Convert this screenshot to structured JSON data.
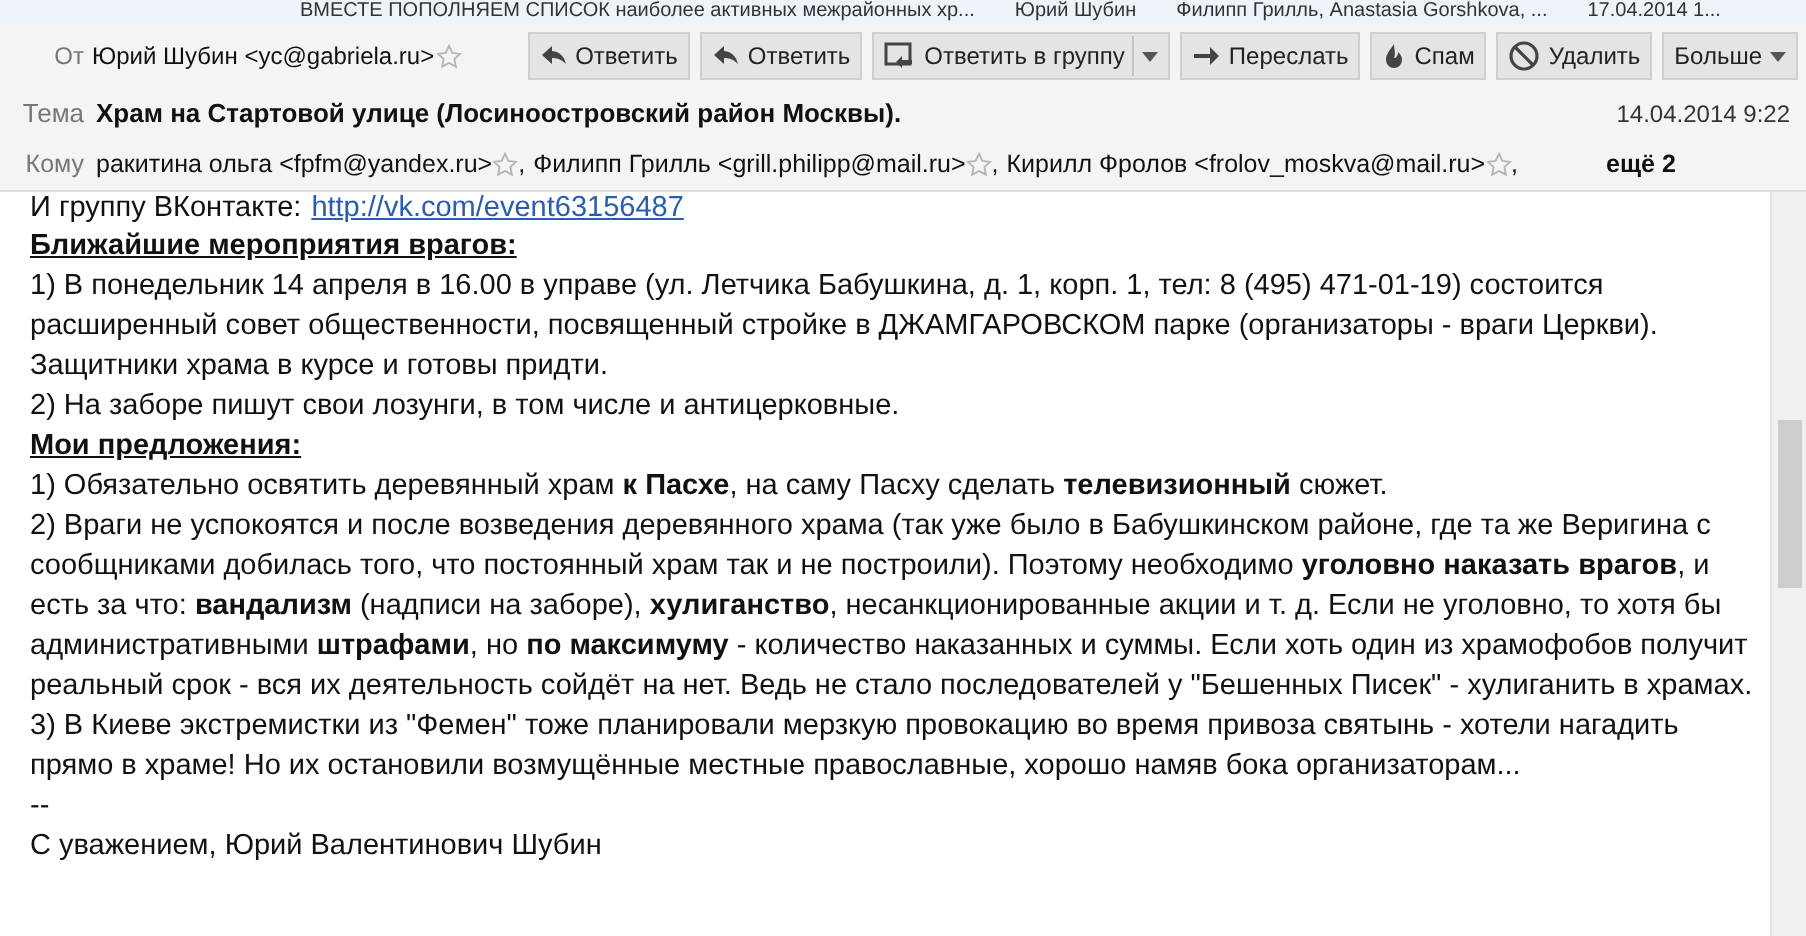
{
  "message_list_row": {
    "subject": "ВМЕСТЕ ПОПОЛНЯЕМ СПИСОК наиболее активных межрайонных хр...",
    "sender": "Юрий Шубин",
    "recipients": "Филипп Грилль, Anastasia Gorshkova, ...",
    "date": "17.04.2014 1..."
  },
  "header": {
    "from_label": "От",
    "from": "Юрий Шубин <yc@gabriela.ru>",
    "buttons": [
      {
        "label": "Ответить",
        "kind": "reply",
        "dropdown": false
      },
      {
        "label": "Ответить",
        "kind": "reply",
        "dropdown": false
      },
      {
        "label": "Ответить в группу",
        "kind": "reply-all",
        "dropdown": true
      },
      {
        "label": "Переслать",
        "kind": "forward",
        "dropdown": false
      },
      {
        "label": "Спам",
        "kind": "spam",
        "dropdown": false
      },
      {
        "label": "Удалить",
        "kind": "delete",
        "dropdown": false
      },
      {
        "label": "Больше",
        "kind": "more",
        "dropdown": true
      }
    ],
    "subject_label": "Тема",
    "subject": "Храм на Стартовой улице (Лосиноостровский район Москвы).",
    "date": "14.04.2014 9:22",
    "to_label": "Кому",
    "recipients": [
      {
        "address": "ракитина ольга <fpfm@yandex.ru>",
        "separator": ","
      },
      {
        "address": "Филипп Грилль <grill.philipp@mail.ru>",
        "separator": ","
      },
      {
        "address": "Кирилл Фролов <frolov_moskva@mail.ru>",
        "separator": ","
      }
    ],
    "more": "ещё 2"
  },
  "body": [
    {
      "kind": "link-line",
      "text": "И группу ВКонтакте:",
      "link": "http://vk.com/event63156487"
    },
    {
      "kind": "heading",
      "text": "Ближайшие мероприятия врагов:"
    },
    {
      "kind": "text",
      "text": "1) В понедельник 14 апреля в 16.00 в управе (ул. Летчика Бабушкина, д. 1, корп. 1, тел: 8 (495) 471-01-19) состоится расширенный совет общественности, посвященный стройке в ДЖАМГАРОВСКОМ парке (организаторы - враги Церкви). Защитники храма в курсе и готовы придти."
    },
    {
      "kind": "text",
      "text": "2) На заборе пишут свои лозунги, в том числе и антицерковные."
    },
    {
      "kind": "heading",
      "text": "Мои предложения:"
    },
    {
      "kind": "text",
      "text": "1) Обязательно освятить деревянный храм **к Пасхе**, на саму Пасху сделать **телевизионный** сюжет."
    },
    {
      "kind": "text",
      "text": "2) Враги не успокоятся и после возведения деревянного храма (так уже было в Бабушкинском районе, где та же Веригина с сообщниками добилась того, что постоянный храм так и не построили). Поэтому необходимо **уголовно наказать врагов**, и есть за что: **вандализм** (надписи на заборе), **хулиганство**, несанкционированные акции и т. д. Если не уголовно, то хотя бы административными **штрафами**, но **по максимуму** - количество наказанных и суммы. Если хоть один из храмофобов получит реальный срок - вся их деятельность сойдёт на нет. Ведь не стало последователей у \"Бешенных Писек\" - хулиганить в храмах."
    },
    {
      "kind": "text",
      "text": "3) В Киеве экстремистки из \"Фемен\" тоже планировали мерзкую провокацию во время привоза святынь - хотели нагадить прямо в храме! Но их остановили возмущённые местные православные, хорошо намяв бока организаторам..."
    },
    {
      "kind": "text",
      "text": "--"
    },
    {
      "kind": "text",
      "text": "С уважением, Юрий Валентинович Шубин"
    }
  ]
}
